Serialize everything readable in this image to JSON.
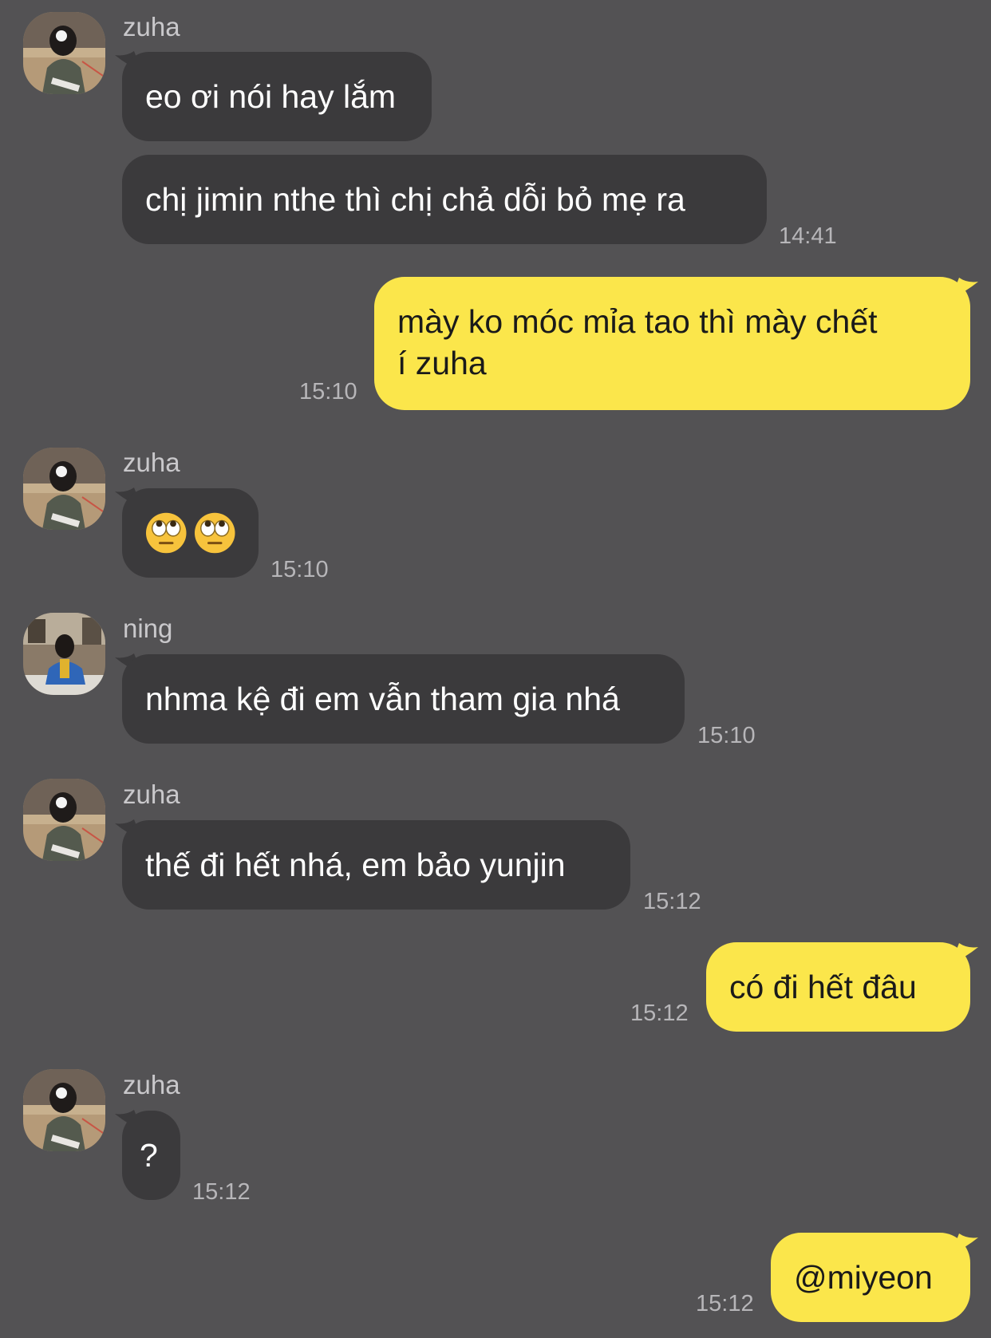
{
  "colors": {
    "background": "#535254",
    "incoming_bubble": "#3b3a3c",
    "outgoing_bubble": "#fbe64b"
  },
  "messages": [
    {
      "sender": "zuha",
      "text": "eo ơi nói hay lắm"
    },
    {
      "text": "chị jimin nthe thì chị chả dỗi bỏ mẹ ra",
      "time": "14:41"
    },
    {
      "text": "mày ko móc mỉa tao thì mày chết\ní zuha",
      "time": "15:10"
    },
    {
      "sender": "zuha",
      "emoji": [
        "face-with-rolling-eyes-emoji",
        "face-with-rolling-eyes-emoji"
      ],
      "time": "15:10"
    },
    {
      "sender": "ning",
      "text": "nhma kệ đi em vẫn tham gia nhá",
      "time": "15:10"
    },
    {
      "sender": "zuha",
      "text": "thế đi hết nhá, em bảo yunjin",
      "time": "15:12"
    },
    {
      "text": "có đi hết đâu",
      "time": "15:12"
    },
    {
      "sender": "zuha",
      "text": "?",
      "time": "15:12"
    },
    {
      "text": "@miyeon",
      "time": "15:12"
    }
  ]
}
